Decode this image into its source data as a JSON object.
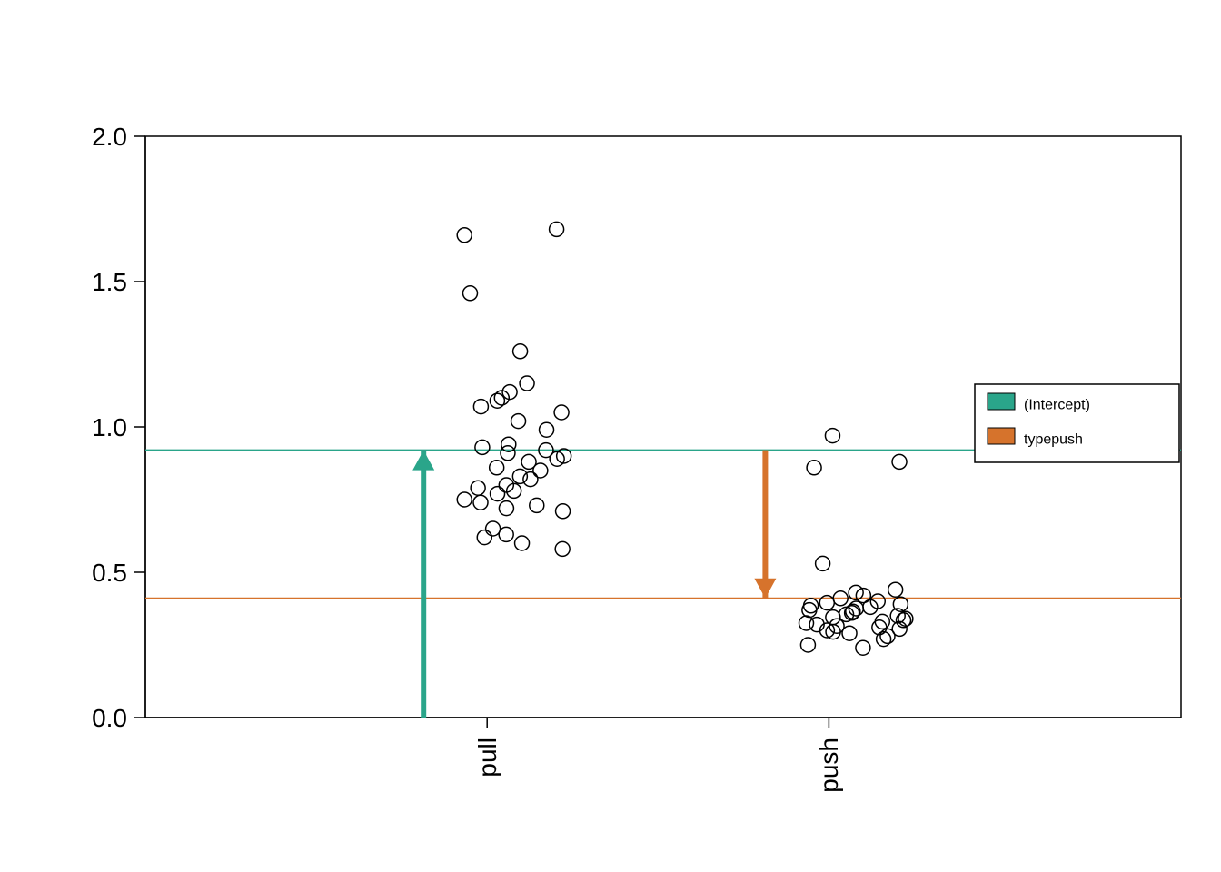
{
  "chart_data": {
    "type": "scatter",
    "title": "",
    "xlabel": "",
    "ylabel": "",
    "x_categories": [
      "pull",
      "push"
    ],
    "ylim": [
      0,
      2.0
    ],
    "y_ticks": [
      0.0,
      0.5,
      1.0,
      1.5,
      2.0
    ],
    "colors": {
      "intercept": "#2AA58A",
      "typepush": "#D6732C"
    },
    "hlines": [
      {
        "name": "(Intercept)",
        "y": 0.92,
        "color_key": "intercept"
      },
      {
        "name": "typepush",
        "y": 0.41,
        "color_key": "typepush"
      }
    ],
    "arrows": [
      {
        "xcat": "pull",
        "y_from": 0.0,
        "y_to": 0.92,
        "color_key": "intercept"
      },
      {
        "xcat": "push",
        "y_from": 0.92,
        "y_to": 0.41,
        "color_key": "typepush"
      }
    ],
    "legend": {
      "items": [
        {
          "label": "(Intercept)",
          "color_key": "intercept"
        },
        {
          "label": "typepush",
          "color_key": "typepush"
        }
      ]
    },
    "series": [
      {
        "name": "pull",
        "xcat": "pull",
        "values": [
          1.66,
          1.68,
          1.46,
          1.26,
          1.1,
          1.12,
          1.15,
          1.07,
          1.09,
          1.02,
          1.05,
          0.99,
          0.93,
          0.9,
          0.92,
          0.94,
          0.89,
          0.91,
          0.88,
          0.86,
          0.85,
          0.83,
          0.82,
          0.8,
          0.79,
          0.77,
          0.78,
          0.75,
          0.74,
          0.72,
          0.71,
          0.73,
          0.65,
          0.63,
          0.62,
          0.6,
          0.58
        ]
      },
      {
        "name": "push",
        "xcat": "push",
        "values": [
          0.97,
          0.88,
          0.86,
          0.53,
          0.43,
          0.44,
          0.41,
          0.42,
          0.4,
          0.39,
          0.395,
          0.38,
          0.385,
          0.37,
          0.375,
          0.36,
          0.365,
          0.35,
          0.355,
          0.34,
          0.345,
          0.33,
          0.335,
          0.32,
          0.325,
          0.31,
          0.315,
          0.3,
          0.305,
          0.295,
          0.29,
          0.28,
          0.27,
          0.25,
          0.24
        ]
      }
    ]
  },
  "y_tick_labels": {
    "0": "0.0",
    "1": "0.5",
    "2": "1.0",
    "3": "1.5",
    "4": "2.0"
  },
  "x_tick_labels": {
    "0": "pull",
    "1": "push"
  },
  "legend_labels": {
    "0": "(Intercept)",
    "1": "typepush"
  }
}
